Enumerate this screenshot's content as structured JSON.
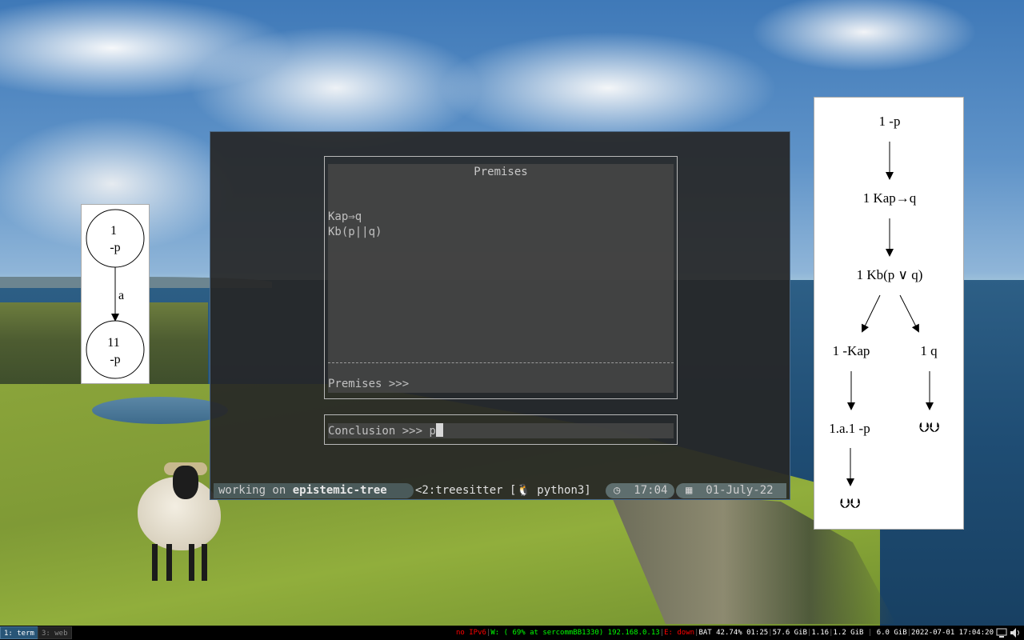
{
  "small_graph": {
    "node1": [
      "1",
      "-p"
    ],
    "edge_label": "a",
    "node2": [
      "11",
      "-p"
    ]
  },
  "big_graph": {
    "nodes": [
      "1 -p",
      "1 Kap→q",
      "1 Kb(p ∨ q)",
      "1 -Kap",
      "1 q",
      "1.a.1 -p"
    ],
    "closed_markers": [
      "⮋⮋",
      "⮋⮋"
    ]
  },
  "terminal": {
    "premises_title": "Premises",
    "premises": [
      "Kap⇒q",
      "Kb(p||q)"
    ],
    "premises_prompt": "Premises >>>",
    "conclusion_prompt": "Conclusion >>> ",
    "conclusion_value": "p"
  },
  "status_bar": {
    "working_prefix": "working on ",
    "project": "epistemic-tree",
    "session": "<2:treesitter [",
    "linux_icon": "penguin-icon",
    "process": " python3]",
    "clock_icon": "clock-icon",
    "time": "17:04",
    "calendar_icon": "calendar-icon",
    "date": "01-July-22"
  },
  "bottom_bar": {
    "workspaces": [
      "1: term",
      "3: web"
    ],
    "ipv6": "no IPv6",
    "wifi": "W: ( 69% at sercommBB1330) 192.168.0.13",
    "ethernet": "E: down",
    "battery": "BAT 42.74% 01:25",
    "disk": "57.6 GiB",
    "load": "1.16",
    "mem_used": "1.2 GiB",
    "mem_free": "6.0 GiB",
    "datetime": "2022-07-01 17:04:20"
  },
  "colors": {
    "status_red": "#ff0000",
    "status_green": "#00ff00",
    "workspace_active": "#285577"
  }
}
